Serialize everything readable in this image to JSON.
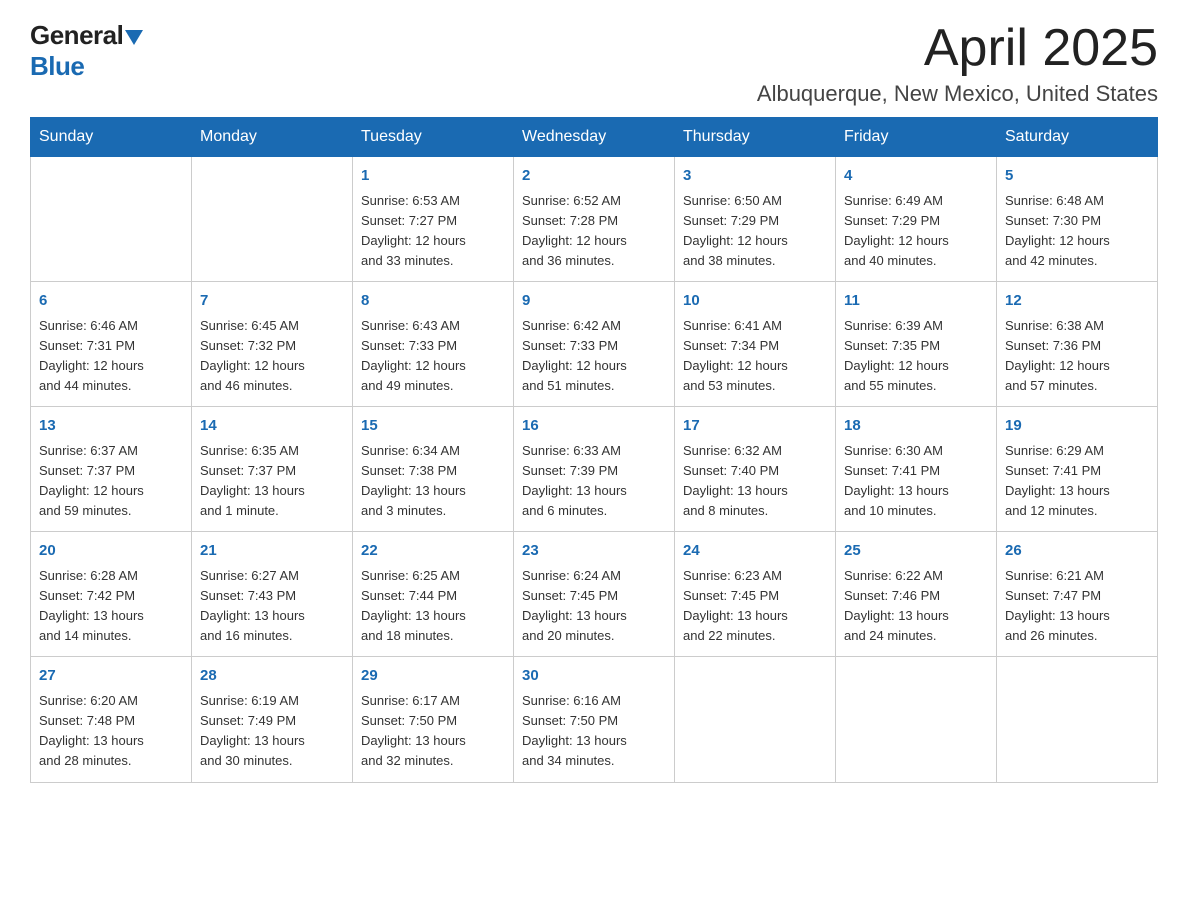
{
  "logo": {
    "text_general": "General",
    "text_blue": "Blue",
    "triangle": "▼"
  },
  "header": {
    "month_year": "April 2025",
    "location": "Albuquerque, New Mexico, United States"
  },
  "columns": [
    "Sunday",
    "Monday",
    "Tuesday",
    "Wednesday",
    "Thursday",
    "Friday",
    "Saturday"
  ],
  "weeks": [
    [
      {
        "day": "",
        "info": ""
      },
      {
        "day": "",
        "info": ""
      },
      {
        "day": "1",
        "info": "Sunrise: 6:53 AM\nSunset: 7:27 PM\nDaylight: 12 hours\nand 33 minutes."
      },
      {
        "day": "2",
        "info": "Sunrise: 6:52 AM\nSunset: 7:28 PM\nDaylight: 12 hours\nand 36 minutes."
      },
      {
        "day": "3",
        "info": "Sunrise: 6:50 AM\nSunset: 7:29 PM\nDaylight: 12 hours\nand 38 minutes."
      },
      {
        "day": "4",
        "info": "Sunrise: 6:49 AM\nSunset: 7:29 PM\nDaylight: 12 hours\nand 40 minutes."
      },
      {
        "day": "5",
        "info": "Sunrise: 6:48 AM\nSunset: 7:30 PM\nDaylight: 12 hours\nand 42 minutes."
      }
    ],
    [
      {
        "day": "6",
        "info": "Sunrise: 6:46 AM\nSunset: 7:31 PM\nDaylight: 12 hours\nand 44 minutes."
      },
      {
        "day": "7",
        "info": "Sunrise: 6:45 AM\nSunset: 7:32 PM\nDaylight: 12 hours\nand 46 minutes."
      },
      {
        "day": "8",
        "info": "Sunrise: 6:43 AM\nSunset: 7:33 PM\nDaylight: 12 hours\nand 49 minutes."
      },
      {
        "day": "9",
        "info": "Sunrise: 6:42 AM\nSunset: 7:33 PM\nDaylight: 12 hours\nand 51 minutes."
      },
      {
        "day": "10",
        "info": "Sunrise: 6:41 AM\nSunset: 7:34 PM\nDaylight: 12 hours\nand 53 minutes."
      },
      {
        "day": "11",
        "info": "Sunrise: 6:39 AM\nSunset: 7:35 PM\nDaylight: 12 hours\nand 55 minutes."
      },
      {
        "day": "12",
        "info": "Sunrise: 6:38 AM\nSunset: 7:36 PM\nDaylight: 12 hours\nand 57 minutes."
      }
    ],
    [
      {
        "day": "13",
        "info": "Sunrise: 6:37 AM\nSunset: 7:37 PM\nDaylight: 12 hours\nand 59 minutes."
      },
      {
        "day": "14",
        "info": "Sunrise: 6:35 AM\nSunset: 7:37 PM\nDaylight: 13 hours\nand 1 minute."
      },
      {
        "day": "15",
        "info": "Sunrise: 6:34 AM\nSunset: 7:38 PM\nDaylight: 13 hours\nand 3 minutes."
      },
      {
        "day": "16",
        "info": "Sunrise: 6:33 AM\nSunset: 7:39 PM\nDaylight: 13 hours\nand 6 minutes."
      },
      {
        "day": "17",
        "info": "Sunrise: 6:32 AM\nSunset: 7:40 PM\nDaylight: 13 hours\nand 8 minutes."
      },
      {
        "day": "18",
        "info": "Sunrise: 6:30 AM\nSunset: 7:41 PM\nDaylight: 13 hours\nand 10 minutes."
      },
      {
        "day": "19",
        "info": "Sunrise: 6:29 AM\nSunset: 7:41 PM\nDaylight: 13 hours\nand 12 minutes."
      }
    ],
    [
      {
        "day": "20",
        "info": "Sunrise: 6:28 AM\nSunset: 7:42 PM\nDaylight: 13 hours\nand 14 minutes."
      },
      {
        "day": "21",
        "info": "Sunrise: 6:27 AM\nSunset: 7:43 PM\nDaylight: 13 hours\nand 16 minutes."
      },
      {
        "day": "22",
        "info": "Sunrise: 6:25 AM\nSunset: 7:44 PM\nDaylight: 13 hours\nand 18 minutes."
      },
      {
        "day": "23",
        "info": "Sunrise: 6:24 AM\nSunset: 7:45 PM\nDaylight: 13 hours\nand 20 minutes."
      },
      {
        "day": "24",
        "info": "Sunrise: 6:23 AM\nSunset: 7:45 PM\nDaylight: 13 hours\nand 22 minutes."
      },
      {
        "day": "25",
        "info": "Sunrise: 6:22 AM\nSunset: 7:46 PM\nDaylight: 13 hours\nand 24 minutes."
      },
      {
        "day": "26",
        "info": "Sunrise: 6:21 AM\nSunset: 7:47 PM\nDaylight: 13 hours\nand 26 minutes."
      }
    ],
    [
      {
        "day": "27",
        "info": "Sunrise: 6:20 AM\nSunset: 7:48 PM\nDaylight: 13 hours\nand 28 minutes."
      },
      {
        "day": "28",
        "info": "Sunrise: 6:19 AM\nSunset: 7:49 PM\nDaylight: 13 hours\nand 30 minutes."
      },
      {
        "day": "29",
        "info": "Sunrise: 6:17 AM\nSunset: 7:50 PM\nDaylight: 13 hours\nand 32 minutes."
      },
      {
        "day": "30",
        "info": "Sunrise: 6:16 AM\nSunset: 7:50 PM\nDaylight: 13 hours\nand 34 minutes."
      },
      {
        "day": "",
        "info": ""
      },
      {
        "day": "",
        "info": ""
      },
      {
        "day": "",
        "info": ""
      }
    ]
  ]
}
